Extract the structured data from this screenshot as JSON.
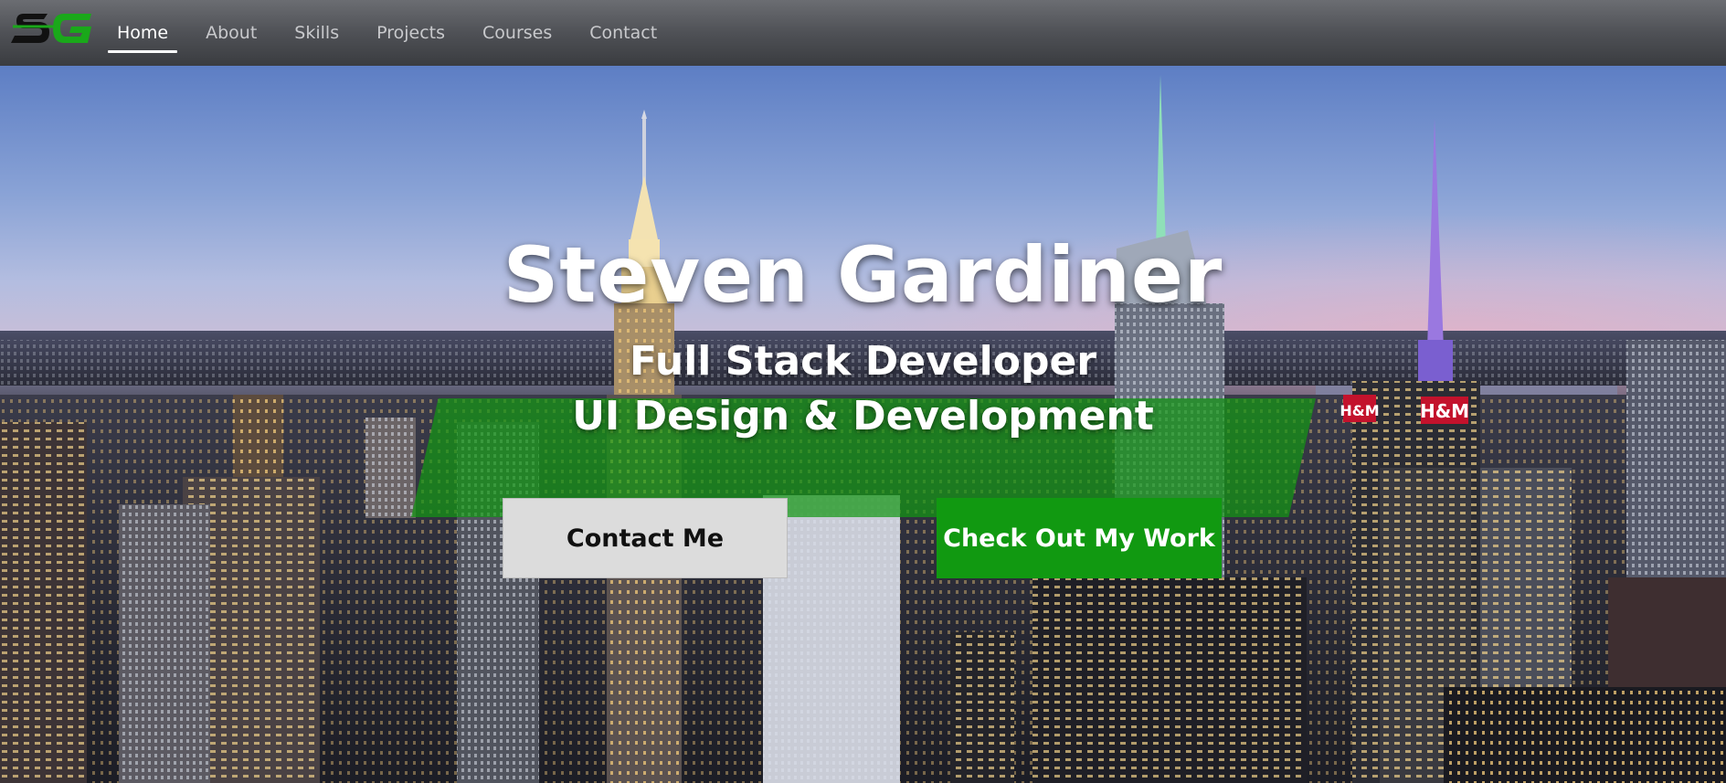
{
  "brand": {
    "logo_text": "SG",
    "accent": "#1aa81a"
  },
  "nav": {
    "items": [
      {
        "label": "Home",
        "active": true
      },
      {
        "label": "About",
        "active": false
      },
      {
        "label": "Skills",
        "active": false
      },
      {
        "label": "Projects",
        "active": false
      },
      {
        "label": "Courses",
        "active": false
      },
      {
        "label": "Contact",
        "active": false
      }
    ]
  },
  "hero": {
    "title": "Steven Gardiner",
    "subtitle_line1": "Full Stack Developer",
    "subtitle_line2": "UI Design & Development",
    "contact_button": "Contact Me",
    "work_button": "Check Out My Work",
    "signs": [
      "H&M",
      "H&M"
    ],
    "colors": {
      "band": "#149614",
      "work_button": "#119911",
      "contact_button": "#dcdcdc"
    }
  }
}
